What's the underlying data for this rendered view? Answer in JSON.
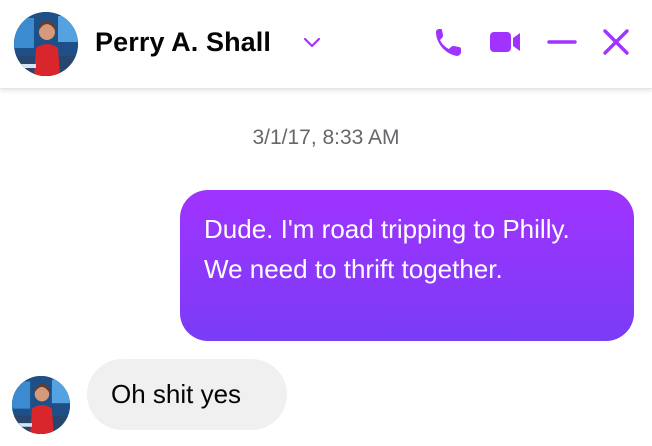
{
  "header": {
    "contact_name": "Perry A. Shall",
    "icons": {
      "call": "phone-icon",
      "video": "video-camera-icon",
      "minimize": "minimize-icon",
      "close": "close-icon",
      "dropdown": "chevron-down-icon"
    },
    "accent_color": "#a033ff"
  },
  "conversation": {
    "timestamp": "3/1/17, 8:33 AM",
    "messages": [
      {
        "sender": "self",
        "text": "Dude. I'm road tripping to Philly. We need to thrift together."
      },
      {
        "sender": "contact",
        "text": "Oh shit yes"
      }
    ]
  },
  "colors": {
    "outgoing_bubble_top": "#a033ff",
    "outgoing_bubble_bottom": "#7a3cf5",
    "incoming_bubble": "#f0f0f0",
    "timestamp_text": "#65676b"
  }
}
